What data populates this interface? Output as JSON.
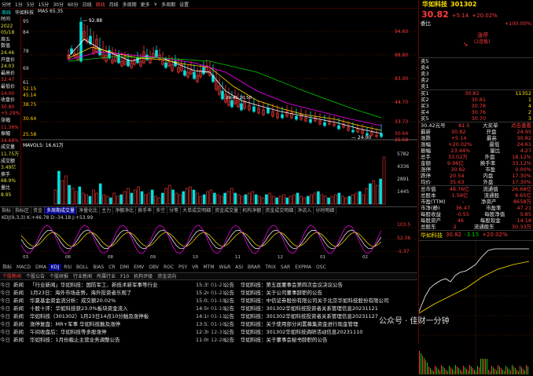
{
  "top_bar": {
    "items": [
      "分时",
      "1分",
      "5分",
      "15分",
      "30分",
      "60分",
      "日线",
      "周线",
      "月线",
      "多周期",
      "更多",
      "∨",
      "多周期",
      "设置"
    ]
  },
  "sub_bar": {
    "period": "周线",
    "stock": "华如科技",
    "ma": "MA5 65.35"
  },
  "left_axis": [
    {
      "label": "时间",
      "value": ""
    },
    {
      "label": "",
      "value": "2022"
    },
    {
      "label": "",
      "value": "05/18"
    },
    {
      "label": "周五",
      "value": ""
    },
    {
      "label": "数值",
      "value": ""
    },
    {
      "label": "",
      "value": "24.46"
    },
    {
      "label": "开盘价",
      "value": ""
    },
    {
      "label": "",
      "value": "24.03"
    },
    {
      "label": "最高价",
      "value": ""
    },
    {
      "label": "",
      "value": "32.47"
    },
    {
      "label": "最低价",
      "value": ""
    },
    {
      "label": "",
      "value": "24.00"
    },
    {
      "label": "收盘价",
      "value": ""
    },
    {
      "label": "",
      "value": "30.80"
    },
    {
      "label": "",
      "value": "+5.29%"
    },
    {
      "label": "涨幅",
      "value": ""
    },
    {
      "label": "",
      "value": "11.36%"
    },
    {
      "label": "振幅",
      "value": ""
    },
    {
      "label": "",
      "value": "34.68%"
    },
    {
      "label": "成交量",
      "value": ""
    },
    {
      "label": "",
      "value": "11.75万"
    },
    {
      "label": "成交额",
      "value": ""
    },
    {
      "label": "",
      "value": "3.49亿"
    },
    {
      "label": "换手",
      "value": ""
    },
    {
      "label": "",
      "value": "68.9%"
    },
    {
      "label": "量比",
      "value": ""
    },
    {
      "label": "",
      "value": "8.95"
    }
  ],
  "kchart": {
    "price_labels": [
      "95",
      "84",
      "78",
      "69",
      "61",
      "52.15",
      "45.14",
      "38.75",
      "30.64",
      "25.58"
    ],
    "right_labels": [
      "94.60",
      "88.80",
      "83.00",
      "44.70",
      "33.73",
      "30.64",
      "25.58"
    ],
    "top_price": "92.88",
    "low_price": "24.00",
    "mid_label": "29.41 20.50"
  },
  "volume": {
    "label": "MAVOL5: 16.61万",
    "right_labels": [
      "5782",
      "4336",
      "2891",
      "1445"
    ]
  },
  "tick_tabs": [
    "指标",
    "指标区",
    "资金",
    "多周期成交量",
    "净量化比",
    "主力",
    "净额净比",
    "换手率",
    "多空",
    "分笔",
    "大单成交明细",
    "资金成交量",
    "机构净额",
    "资金成交明细",
    "净流入",
    "分时明细"
  ],
  "kdj": {
    "label": "KDJ(9,3,3) K:+46.78 D:-34.18 J:+53.99",
    "right_labels": [
      "103.5",
      "52.36",
      "-1.37"
    ],
    "dates": [
      "03",
      "06",
      "08",
      "09",
      "10",
      "11",
      "12",
      "01",
      "02"
    ]
  },
  "ind_tabs": [
    "指标",
    "MACD",
    "DMA",
    "KDJ",
    "RSI",
    "BOLL",
    "BIAS",
    "CR",
    "DMI",
    "EMV",
    "OBV",
    "ROC",
    "PSY",
    "VR",
    "MTM",
    "W&R",
    "ASI",
    "BRAR",
    "TRIX",
    "SAR",
    "EXPMA",
    "OSC"
  ],
  "news_tabs": [
    "个股新闻",
    "个股公告",
    "个股研报",
    "行业新闻",
    "所属行业",
    "F10",
    "机构评级",
    "资金流向"
  ],
  "news_left": [
    {
      "date": "今日",
      "src": "新闻",
      "title": "「行业新闻」华如科技：国防军工、新技术新军事等行业",
      "time": "15:35"
    },
    {
      "date": "今日",
      "src": "新闻",
      "title": "1月23日：海外市场走势，海外投资者乐观了",
      "time": "15:26"
    },
    {
      "date": "今日",
      "src": "新闻",
      "title": "华夏基金资金流分析：成交额20.02%",
      "time": "15:02"
    },
    {
      "date": "今日",
      "src": "新闻",
      "title": "十股十评：华如科技获23.0%板块资金流入",
      "time": "14:56"
    },
    {
      "date": "今日",
      "src": "新闻",
      "title": "华如科技（301302）1月23日14点10分触及涨停板",
      "time": "14:10"
    },
    {
      "date": "今日",
      "src": "新闻",
      "title": "涨停复盘：MR+军事 华如科技触及涨停",
      "time": "13:53"
    },
    {
      "date": "今日",
      "src": "新闻",
      "title": "午间收盘后：华如科技等多股涨停",
      "time": "12:30"
    },
    {
      "date": "今日",
      "src": "新闻",
      "title": "华如科技：1月份截止主营业务调整公告",
      "time": "11:00"
    }
  ],
  "news_right": [
    {
      "date": "01-21",
      "src": "公告",
      "title": "华如科技：第五届董事会第四次会议决议公告",
      "time": ""
    },
    {
      "date": "01-21",
      "src": "公告",
      "title": "华如科技：关于公司董事辞职的公告",
      "time": ""
    },
    {
      "date": "01-19",
      "src": "公告",
      "title": "华如科技：中信证券股份有限公司关于北京华如科技股份有限公司",
      "time": ""
    },
    {
      "date": "01-19",
      "src": "公告",
      "title": "华如科技：301302华如科技投资者关系管理信息20231121",
      "time": ""
    },
    {
      "date": "01-11",
      "src": "公告",
      "title": "华如科技：301302华如科技投资者关系管理信息20231127",
      "time": ""
    },
    {
      "date": "01-10",
      "src": "公告",
      "title": "华如科技：关于使用部分闲置募集资金进行现金管理",
      "time": ""
    },
    {
      "date": "12-31",
      "src": "公告",
      "title": "华如科技：301302华如科技调研活动信息20231110",
      "time": ""
    },
    {
      "date": "12-28",
      "src": "公告",
      "title": "华如科技：关于董事会秘书辞职的公告",
      "time": ""
    }
  ],
  "quote": {
    "name": "华如科技",
    "code": "301302",
    "price": "30.82",
    "change": "+5.14",
    "pct": "+20.02%",
    "sector": "委比",
    "sector_val": "+100.00%",
    "limit_label": "涨停",
    "limit_sub": "(2连板)",
    "sell": [
      {
        "l": "卖5",
        "p": "",
        "v": ""
      },
      {
        "l": "卖4",
        "p": "",
        "v": ""
      },
      {
        "l": "卖3",
        "p": "",
        "v": ""
      },
      {
        "l": "卖2",
        "p": "",
        "v": ""
      },
      {
        "l": "卖1",
        "p": "",
        "v": ""
      }
    ],
    "buy": [
      {
        "l": "买1",
        "p": "30.82",
        "v": "11352"
      },
      {
        "l": "买2",
        "p": "30.81",
        "v": "1"
      },
      {
        "l": "买3",
        "p": "30.78",
        "v": "4"
      },
      {
        "l": "买4",
        "p": "30.76",
        "v": "2"
      },
      {
        "l": "买5",
        "p": "30.70",
        "v": "3"
      }
    ],
    "lines": [
      [
        "30.42元号",
        "81.5",
        "大买单",
        "点击查看"
      ],
      [
        "最新",
        "30.82",
        "开盘",
        "24.95"
      ],
      [
        "涨跌",
        "+5.14",
        "最高",
        "30.82"
      ],
      [
        "涨幅",
        "+20.02%",
        "最低",
        "24.61"
      ],
      [
        "振幅",
        "23.44%",
        "量比",
        "4.27"
      ],
      [
        "总手",
        "33.02万",
        "外盘",
        "18.12%"
      ],
      [
        "金额",
        "9.96亿",
        "换手率",
        "33.12%"
      ],
      [
        "涨停",
        "30.82",
        "市盈",
        "0.00%"
      ],
      [
        "跌停",
        "20.54",
        "内盘",
        "17.30%"
      ],
      [
        "均价",
        "35.63",
        "外盘",
        "17.30%"
      ]
    ],
    "lines2": [
      [
        "总市值",
        "48.76亿",
        "流通值",
        "26.68亿"
      ],
      [
        "总股本",
        "1.58亿",
        "流通股",
        "8.65亿"
      ],
      [
        "市盈(TTM)",
        "-",
        "净资产",
        "8658万"
      ],
      [
        "市净(静)",
        "36.47",
        "市盈率",
        "47.21"
      ],
      [
        "每股收益",
        "-0.55",
        "每股净值",
        "5.85"
      ],
      [
        "每股资产",
        "46",
        "每股现金",
        "14.18"
      ],
      [
        "总股东",
        "2",
        "流通股东",
        "30.33万"
      ]
    ],
    "mini_label": "华如科技",
    "mini_vals": [
      "30.82",
      "-3.15",
      "+20.02%"
    ]
  },
  "watermark": "公众号 · 佳财一分钟",
  "colors": {
    "up": "#ff3b3b",
    "down": "#00d000",
    "ma5": "#ffffff",
    "ma10": "#ffe000",
    "ma20": "#ff00ff",
    "ma60": "#00d000",
    "accent": "#00008a"
  }
}
